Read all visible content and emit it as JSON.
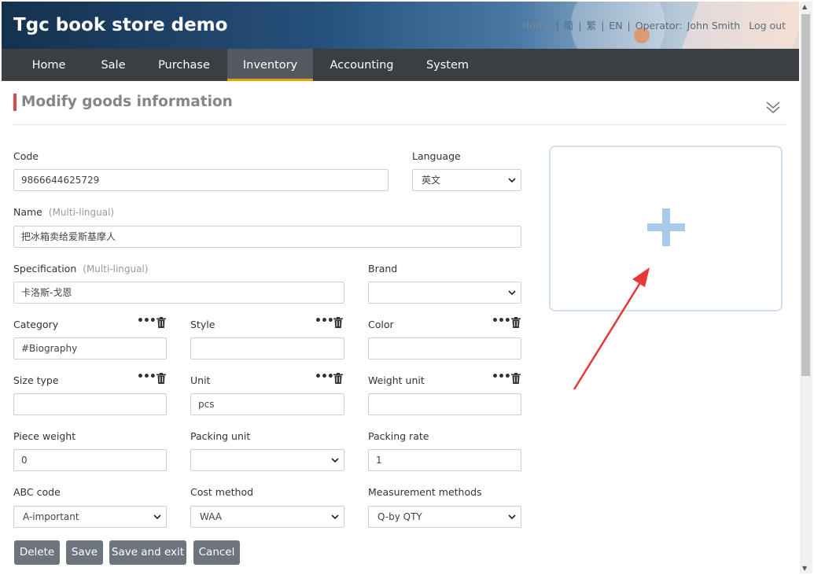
{
  "header": {
    "app_title": "Tgc book store demo",
    "links": [
      "Home",
      "简",
      "繁",
      "EN"
    ],
    "operator_label": "Operator:",
    "operator_name": "John Smith",
    "logout": "Log out"
  },
  "nav": {
    "items": [
      "Home",
      "Sale",
      "Purchase",
      "Inventory",
      "Accounting",
      "System"
    ],
    "active": "Inventory"
  },
  "page": {
    "title": "Modify goods information"
  },
  "form": {
    "code": {
      "label": "Code",
      "value": "9866644625729"
    },
    "language": {
      "label": "Language",
      "value": "英文"
    },
    "name": {
      "label": "Name",
      "hint": "(Multi-lingual)",
      "value": "把冰箱卖给爱斯基摩人"
    },
    "specification": {
      "label": "Specification",
      "hint": "(Multi-lingual)",
      "value": "卡洛斯-戈恩"
    },
    "brand": {
      "label": "Brand",
      "value": ""
    },
    "category": {
      "label": "Category",
      "value": "#Biography"
    },
    "style": {
      "label": "Style",
      "value": ""
    },
    "color": {
      "label": "Color",
      "value": ""
    },
    "size_type": {
      "label": "Size type",
      "value": ""
    },
    "unit": {
      "label": "Unit",
      "value": "pcs"
    },
    "weight_unit": {
      "label": "Weight unit",
      "value": ""
    },
    "piece_weight": {
      "label": "Piece weight",
      "value": "0"
    },
    "packing_unit": {
      "label": "Packing unit",
      "value": ""
    },
    "packing_rate": {
      "label": "Packing rate",
      "value": "1"
    },
    "abc_code": {
      "label": "ABC code",
      "value": "A-important"
    },
    "cost_method": {
      "label": "Cost method",
      "value": "WAA"
    },
    "measurement_methods": {
      "label": "Measurement methods",
      "value": "Q-by QTY"
    }
  },
  "buttons": {
    "delete": "Delete",
    "save": "Save",
    "save_exit": "Save and exit",
    "cancel": "Cancel"
  },
  "icons": {
    "more": "more-dots-icon",
    "trash": "trash-icon",
    "plus": "plus-icon",
    "collapse": "double-chevron-down-icon",
    "dropdown": "chevron-down-icon"
  },
  "colors": {
    "nav_bg": "#3b3f44",
    "nav_active_underline": "#e2a200",
    "title_accent": "#d94b4b",
    "button_bg": "#6c757d",
    "upload_plus": "#a9c9ea",
    "annotation_arrow": "#e53935"
  }
}
